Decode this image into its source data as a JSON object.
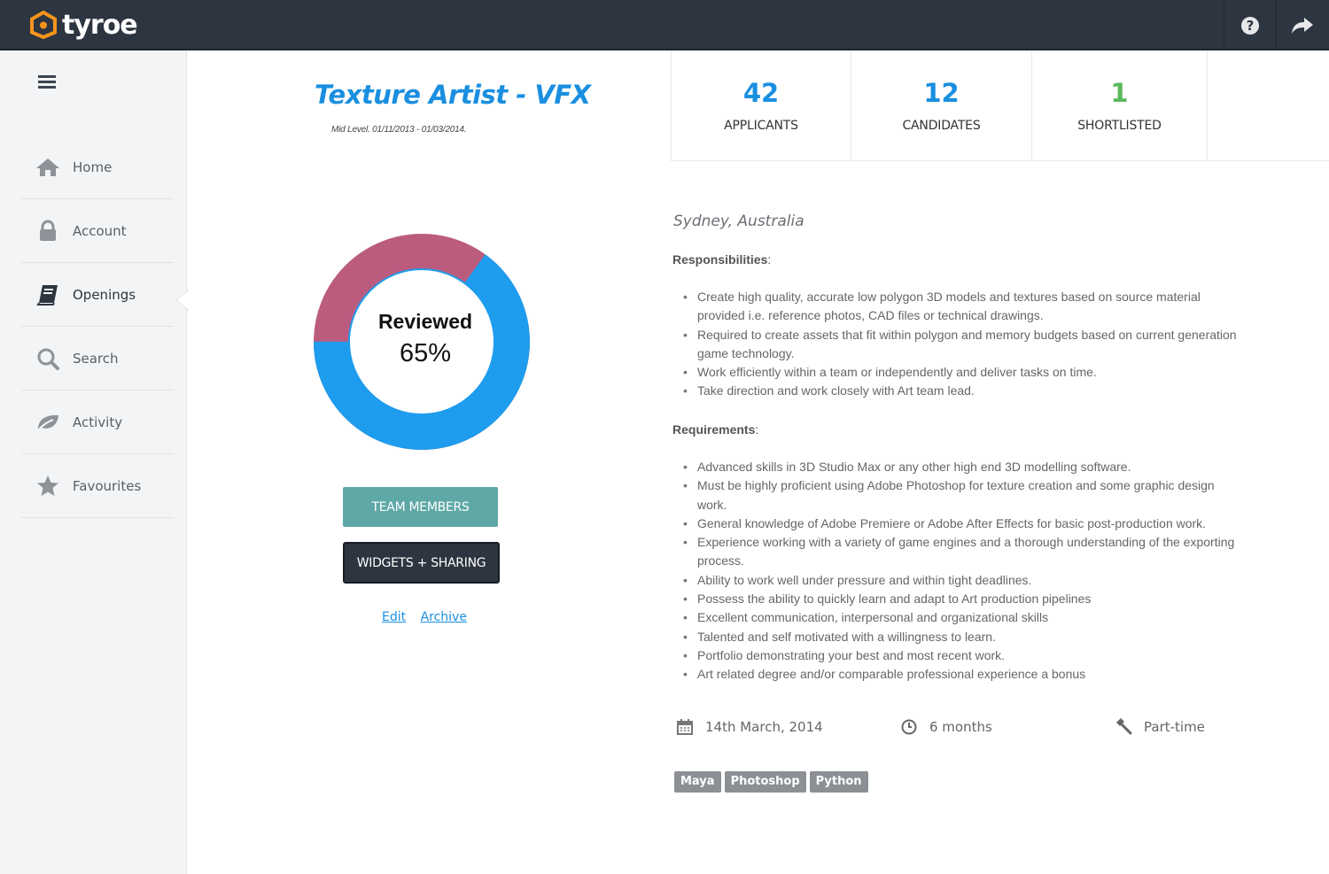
{
  "app": {
    "brand": "tyroe",
    "accent": "#1a8fe0",
    "brand_orange": "#f7941d"
  },
  "topbar": {
    "help_icon": "help-icon",
    "share_icon": "share-arrow-icon"
  },
  "sidebar": {
    "items": [
      {
        "label": "Home",
        "icon": "home-icon"
      },
      {
        "label": "Account",
        "icon": "lock-icon"
      },
      {
        "label": "Openings",
        "icon": "book-icon",
        "active": true
      },
      {
        "label": "Search",
        "icon": "search-icon"
      },
      {
        "label": "Activity",
        "icon": "leaf-icon"
      },
      {
        "label": "Favourites",
        "icon": "star-icon"
      }
    ]
  },
  "job": {
    "title": "Texture Artist - VFX",
    "meta": "Mid Level. 01/11/2013 - 01/03/2014.",
    "progress": {
      "label": "Reviewed",
      "percent_text": "65%",
      "value": 0.65,
      "color_done": "#1e9cee",
      "color_rest": "#bb5c7f"
    },
    "buttons": {
      "team": "TEAM MEMBERS",
      "widgets": "WIDGETS + SHARING"
    },
    "links": {
      "edit": "Edit",
      "archive": "Archive"
    }
  },
  "stats": [
    {
      "value": "42",
      "label": "APPLICANTS",
      "color": "#1a8fe0"
    },
    {
      "value": "12",
      "label": "CANDIDATES",
      "color": "#1a8fe0"
    },
    {
      "value": "1",
      "label": "SHORTLISTED",
      "color": "#5cb85c"
    }
  ],
  "details": {
    "location": "Sydney, Australia",
    "responsibilities_heading": "Responsibilities",
    "responsibilities": [
      "Create high quality, accurate low polygon 3D models and textures based on source material provided i.e. reference photos, CAD files or technical drawings.",
      "Required to create assets that fit within polygon and memory budgets based on current generation game technology.",
      "Work efficiently within a team or independently and deliver tasks on time.",
      "Take direction and work closely with Art team lead."
    ],
    "requirements_heading": "Requirements",
    "requirements": [
      "Advanced skills in 3D Studio Max or any other high end 3D modelling software.",
      "Must be highly proficient using Adobe Photoshop for texture creation and some graphic design work.",
      "General knowledge of Adobe Premiere or Adobe After Effects for basic post-production work.",
      "Experience working with a variety of game engines and a thorough understanding of the exporting process.",
      "Ability to work well under pressure and within tight deadlines.",
      "Possess the ability to quickly learn and adapt to Art production pipelines",
      "Excellent communication, interpersonal and organizational skills",
      "Talented and self motivated with a willingness to learn.",
      "Portfolio demonstrating your best and most recent work.",
      "Art related degree and/or comparable professional experience a bonus"
    ],
    "date": "14th March, 2014",
    "duration": "6 months",
    "type": "Part-time",
    "tags": [
      "Maya",
      "Photoshop",
      "Python"
    ]
  }
}
